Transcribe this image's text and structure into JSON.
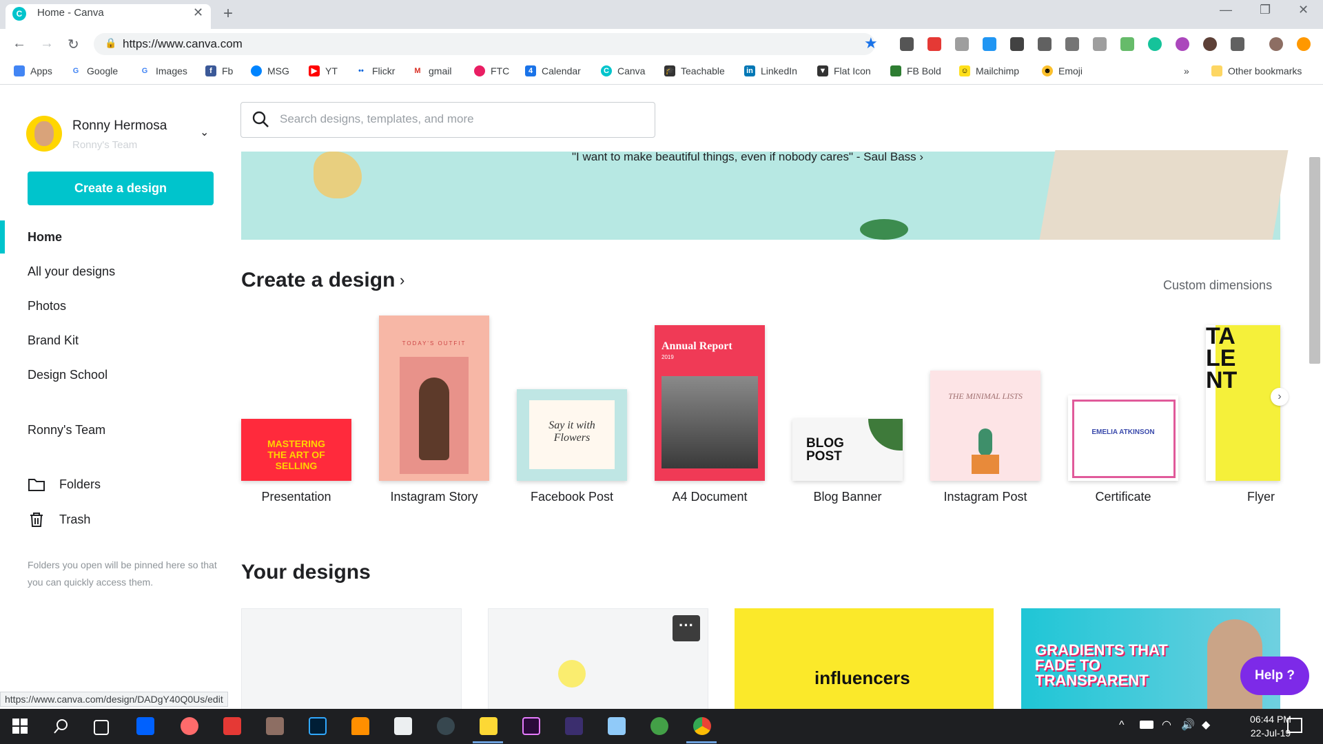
{
  "browser": {
    "tab_title": "Home - Canva",
    "url": "https://www.canva.com",
    "status_url": "https://www.canva.com/design/DADgY40Q0Us/edit",
    "bookmarks": [
      "Apps",
      "Google",
      "Images",
      "Fb",
      "MSG",
      "YT",
      "Flickr",
      "gmail",
      "FTC",
      "Calendar",
      "Canva",
      "Teachable",
      "LinkedIn",
      "Flat Icon",
      "FB Bold",
      "Mailchimp",
      "Emoji"
    ],
    "other_bookmarks": "Other bookmarks"
  },
  "sidebar": {
    "user_name": "Ronny Hermosa",
    "team_name": "Ronny's Team",
    "create_button": "Create a design",
    "nav": [
      "Home",
      "All your designs",
      "Photos",
      "Brand Kit",
      "Design School"
    ],
    "team_link": "Ronny's Team",
    "folders": "Folders",
    "trash": "Trash",
    "pinned_note": "Folders you open will be pinned here so that you can quickly access them."
  },
  "main": {
    "search_placeholder": "Search designs, templates, and more",
    "banner_quote": "\"I want to make beautiful things, even if nobody cares\" - Saul Bass ›",
    "create_title": "Create a design",
    "custom_dimensions": "Custom dimensions",
    "design_types": [
      "Presentation",
      "Instagram Story",
      "Facebook Post",
      "A4 Document",
      "Blog Banner",
      "Instagram Post",
      "Certificate",
      "Flyer"
    ],
    "thumb_text": {
      "presentation": "MASTERING THE ART OF SELLING",
      "story": "TODAY'S OUTFIT",
      "facebook": "Say it with Flowers",
      "report": "Annual Report",
      "report_year": "2019",
      "blog": "BLOG POST",
      "insta": "THE MINIMAL LISTS",
      "certificate_name": "EMELIA ATKINSON",
      "flyer": "TA LE NT"
    },
    "your_designs_title": "Your designs",
    "design_cards": [
      "",
      "",
      "influencers",
      "GRADIENTS THAT FADE TO TRANSPARENT"
    ],
    "help_button": "Help ?"
  },
  "taskbar": {
    "time": "06:44 PM",
    "date": "22-Jul-19"
  },
  "colors": {
    "accent": "#00c4cc",
    "help": "#7d2ae8"
  }
}
